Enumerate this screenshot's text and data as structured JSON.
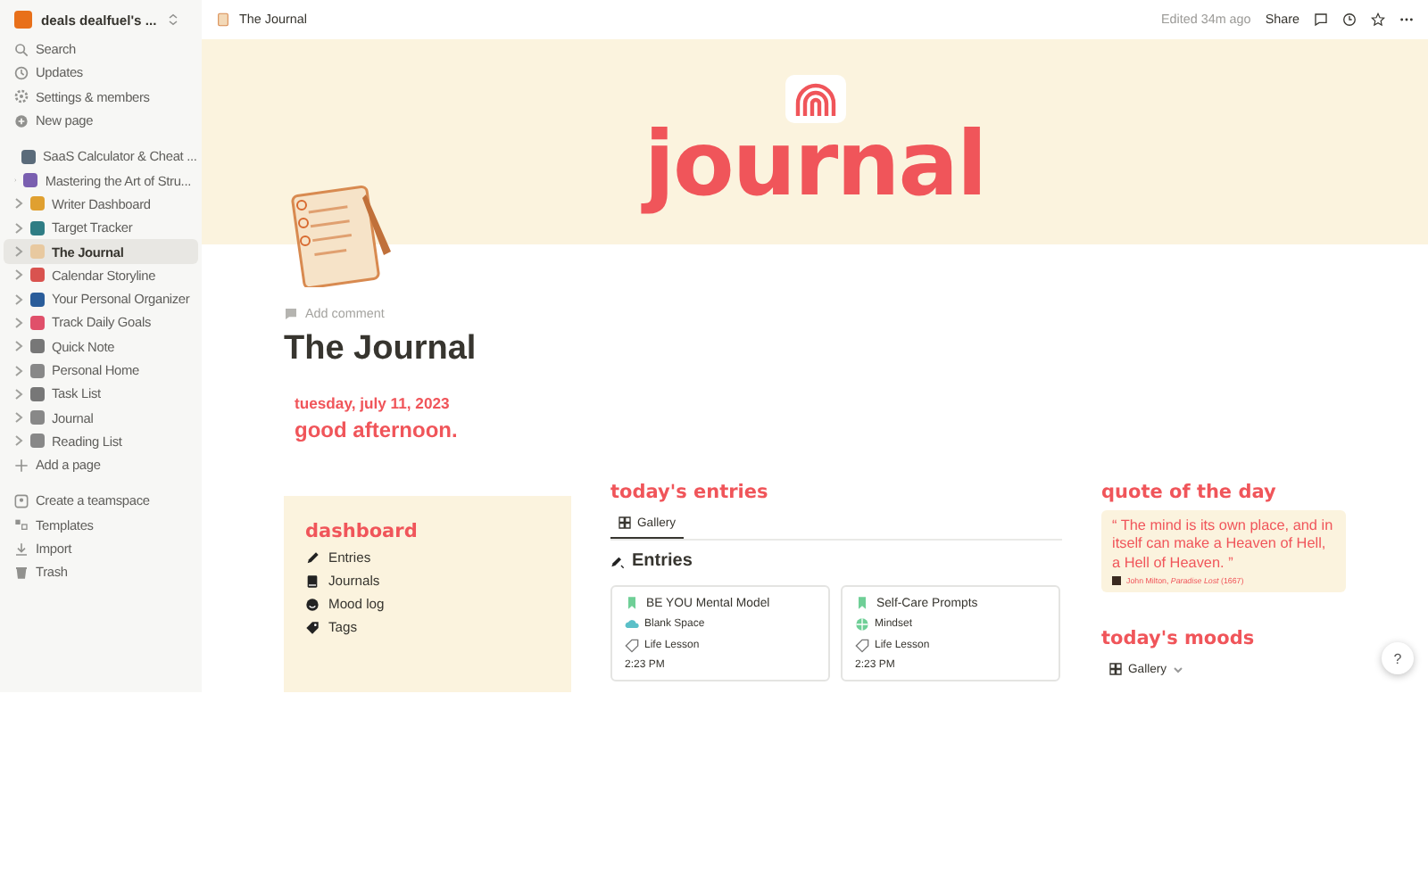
{
  "workspace": {
    "name": "deals dealfuel's ..."
  },
  "sidebar": {
    "actions": [
      "Search",
      "Updates",
      "Settings & members",
      "New page"
    ],
    "pages": [
      {
        "label": "SaaS Calculator & Cheat ...",
        "selected": false
      },
      {
        "label": "Mastering the Art of Stru...",
        "selected": false
      },
      {
        "label": "Writer Dashboard",
        "selected": false
      },
      {
        "label": "Target Tracker",
        "selected": false
      },
      {
        "label": "The Journal",
        "selected": true
      },
      {
        "label": "Calendar Storyline",
        "selected": false
      },
      {
        "label": "Your Personal Organizer",
        "selected": false
      },
      {
        "label": "Track Daily Goals",
        "selected": false
      },
      {
        "label": "Quick Note",
        "selected": false
      },
      {
        "label": "Personal Home",
        "selected": false
      },
      {
        "label": "Task List",
        "selected": false
      },
      {
        "label": "Journal",
        "selected": false
      },
      {
        "label": "Reading List",
        "selected": false
      }
    ],
    "add_page": "Add a page",
    "footer": [
      "Create a teamspace",
      "Templates",
      "Import",
      "Trash"
    ]
  },
  "topbar": {
    "breadcrumb": "The Journal",
    "edited": "Edited 34m ago",
    "share": "Share"
  },
  "cover": {
    "title": "journal"
  },
  "page": {
    "add_comment": "Add comment",
    "title": "The Journal",
    "date": "tuesday, july 11, 2023",
    "greeting": "good afternoon."
  },
  "dashboard": {
    "heading": "dashboard",
    "links": [
      "Entries",
      "Journals",
      "Mood log",
      "Tags"
    ]
  },
  "entries": {
    "heading": "today's entries",
    "view_tab": "Gallery",
    "database_title": "Entries",
    "cards": [
      {
        "title": "BE YOU Mental Model",
        "tag": "Blank Space",
        "category": "Life Lesson",
        "time": "2:23 PM"
      },
      {
        "title": "Self-Care Prompts",
        "tag": "Mindset",
        "category": "Life Lesson",
        "time": "2:23 PM"
      }
    ]
  },
  "quote": {
    "heading": "quote of the day",
    "text": "“ The mind is its own place, and in itself can make a Heaven of Hell, a Hell of Heaven. ”",
    "citation": "John Milton, *Paradise Lost* (1667)"
  },
  "moods": {
    "heading": "today's moods",
    "view_tab": "Gallery"
  },
  "help": "?"
}
